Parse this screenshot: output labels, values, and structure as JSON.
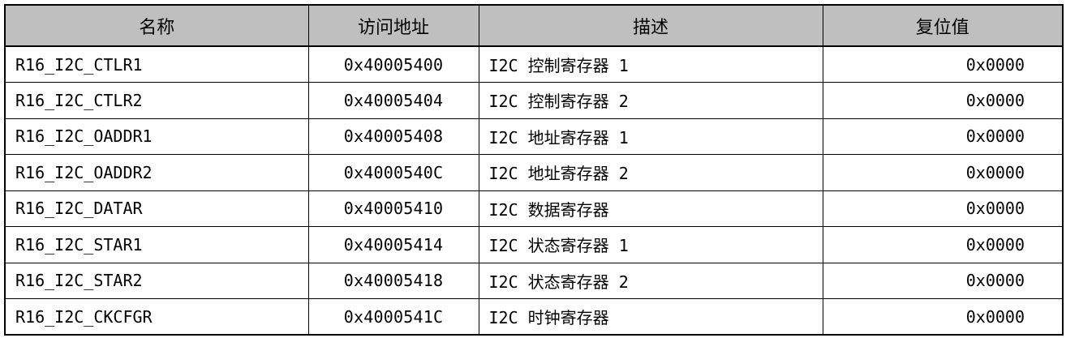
{
  "table": {
    "headers": {
      "name": "名称",
      "address": "访问地址",
      "description": "描述",
      "reset": "复位值"
    },
    "rows": [
      {
        "name": "R16_I2C_CTLR1",
        "address": "0x40005400",
        "description": "I2C 控制寄存器 1",
        "reset": "0x0000"
      },
      {
        "name": "R16_I2C_CTLR2",
        "address": "0x40005404",
        "description": "I2C 控制寄存器 2",
        "reset": "0x0000"
      },
      {
        "name": "R16_I2C_OADDR1",
        "address": "0x40005408",
        "description": "I2C 地址寄存器 1",
        "reset": "0x0000"
      },
      {
        "name": "R16_I2C_OADDR2",
        "address": "0x4000540C",
        "description": "I2C 地址寄存器 2",
        "reset": "0x0000"
      },
      {
        "name": "R16_I2C_DATAR",
        "address": "0x40005410",
        "description": "I2C 数据寄存器",
        "reset": "0x0000"
      },
      {
        "name": "R16_I2C_STAR1",
        "address": "0x40005414",
        "description": "I2C 状态寄存器 1",
        "reset": "0x0000"
      },
      {
        "name": "R16_I2C_STAR2",
        "address": "0x40005418",
        "description": "I2C 状态寄存器 2",
        "reset": "0x0000"
      },
      {
        "name": "R16_I2C_CKCFGR",
        "address": "0x4000541C",
        "description": "I2C 时钟寄存器",
        "reset": "0x0000"
      }
    ]
  }
}
